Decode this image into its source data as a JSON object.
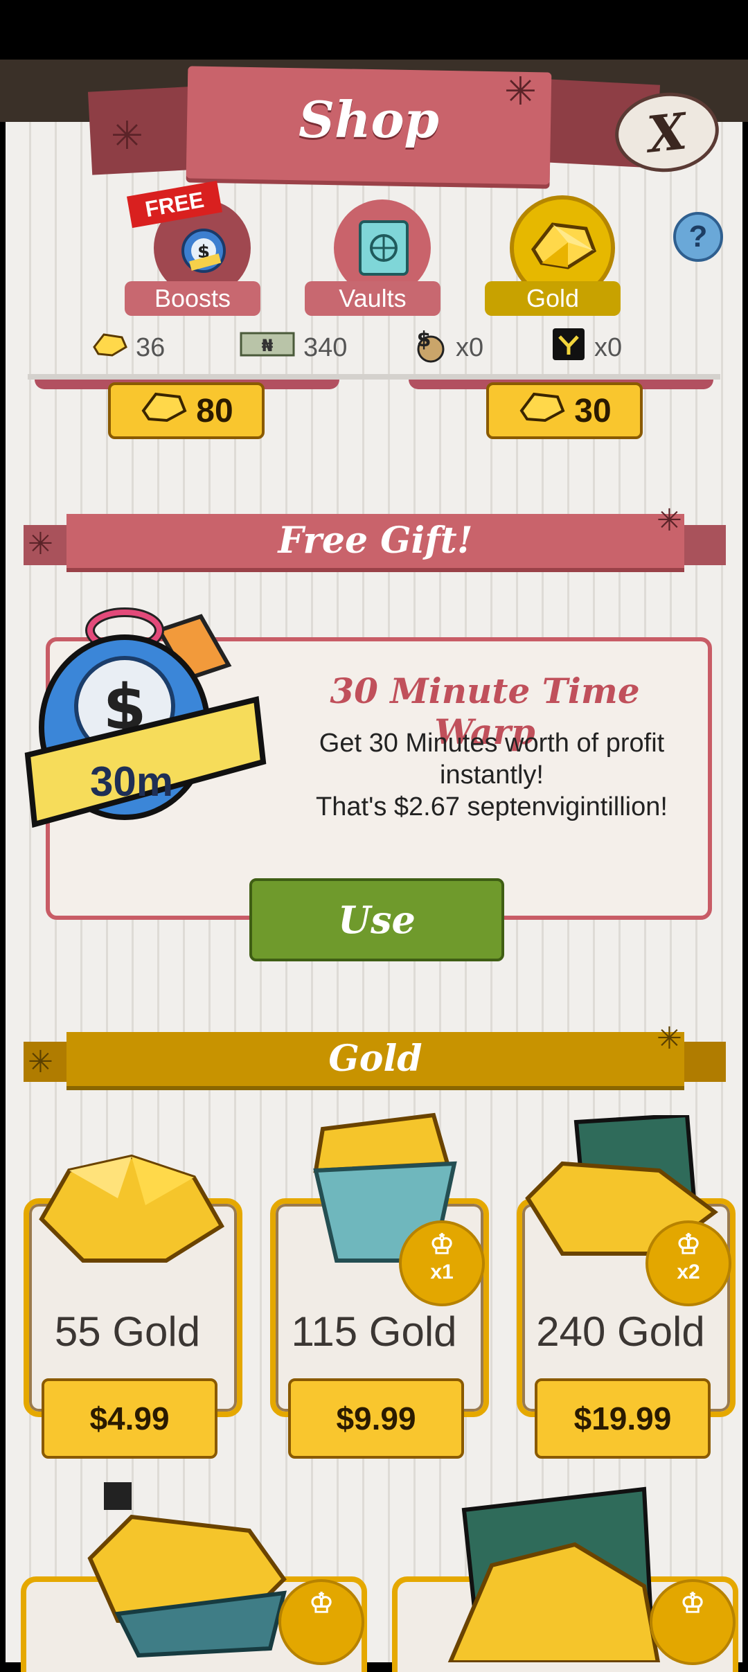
{
  "header": {
    "title": "Shop",
    "close_label": "X"
  },
  "tabs": [
    {
      "label": "Boosts",
      "ribbon": "FREE",
      "icon": "stopwatch-moneybag-icon"
    },
    {
      "label": "Vaults",
      "icon": "vault-icon"
    },
    {
      "label": "Gold",
      "icon": "gold-nugget-icon",
      "active": true
    }
  ],
  "help_label": "?",
  "currencies": [
    {
      "icon": "gold-icon",
      "value": "36"
    },
    {
      "icon": "megabucks-icon",
      "value": "340"
    },
    {
      "icon": "moneybag-icon",
      "value": "x0"
    },
    {
      "icon": "angel-investor-icon",
      "value": "x0"
    }
  ],
  "partial_prices": [
    "80",
    "30"
  ],
  "free_gift": {
    "banner": "Free Gift!",
    "badge": "30m",
    "title": "30 Minute Time Warp",
    "desc_line1": "Get 30 Minutes worth of profit",
    "desc_line2": "instantly!",
    "desc_line3": "That's $2.67 septenvigintillion!",
    "button": "Use"
  },
  "gold_section": {
    "banner": "Gold",
    "items": [
      {
        "label": "55 Gold",
        "price": "$4.99",
        "badge": ""
      },
      {
        "label": "115 Gold",
        "price": "$9.99",
        "badge": "x1"
      },
      {
        "label": "240 Gold",
        "price": "$19.99",
        "badge": "x2"
      }
    ]
  },
  "colors": {
    "accent_red": "#c9636b",
    "gold": "#e6b800",
    "green": "#6f9a2c"
  }
}
